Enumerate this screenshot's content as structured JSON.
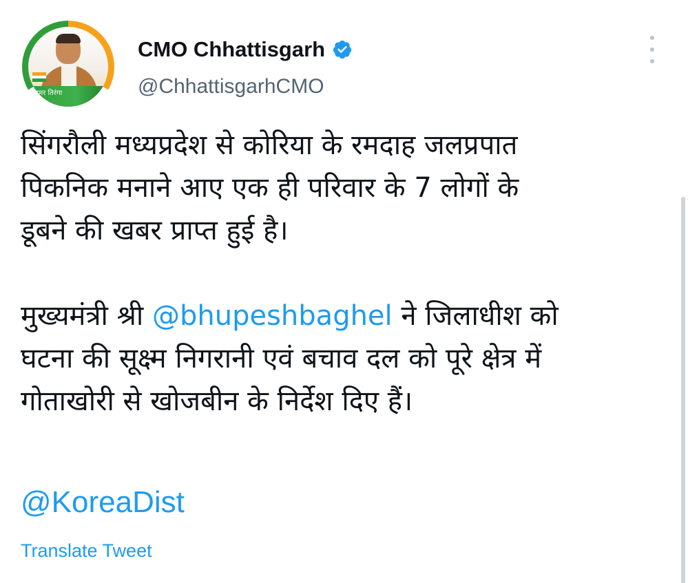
{
  "profile": {
    "display_name": "CMO Chhattisgarh",
    "handle": "@ChhattisgarhCMO",
    "avatar_text": "हमर तिरंगा",
    "verified": true
  },
  "tweet": {
    "paragraph1_lines": [
      "सिंगरौली मध्यप्रदेश से कोरिया के रमदाह जलप्रपात",
      "पिकनिक मनाने आए एक ही परिवार के 7 लोगों के",
      "डूबने की खबर प्राप्त हुई है।"
    ],
    "paragraph2_prefix": "मुख्यमंत्री श्री ",
    "paragraph2_mention": "@bhupeshbaghel",
    "paragraph2_suffix_line1": " ने जिलाधीश को",
    "paragraph2_lines": [
      "घटना की सूक्ष्म निगरानी एवं बचाव दल को पूरे क्षेत्र में",
      "गोताखोरी से खोजबीन के निर्देश दिए हैं।"
    ],
    "mention_line": "@KoreaDist",
    "translate_label": "Translate Tweet"
  },
  "colors": {
    "link": "#1d9bf0",
    "text": "#0f1419",
    "muted": "#536471"
  },
  "icons": {
    "verified": "verified-badge-icon",
    "more": "more-vertical-icon"
  }
}
